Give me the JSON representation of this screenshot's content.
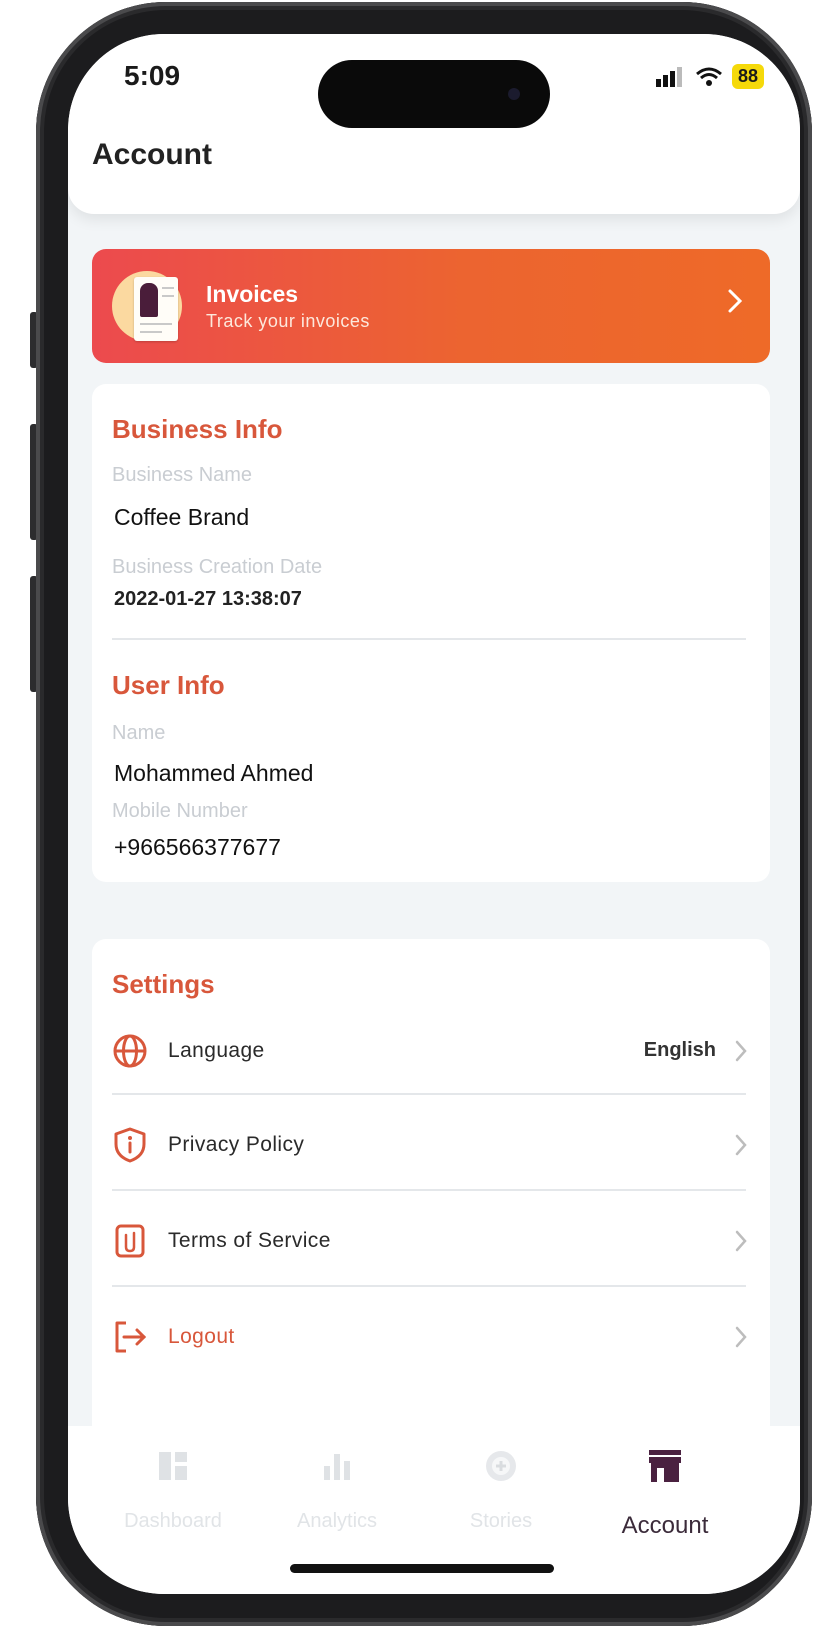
{
  "status_bar": {
    "time": "5:09",
    "battery": "88"
  },
  "header": {
    "title": "Account"
  },
  "invoices": {
    "title": "Invoices",
    "subtitle": "Track your invoices"
  },
  "business_info": {
    "section_title": "Business Info",
    "name_label": "Business Name",
    "name_value": "Coffee Brand",
    "date_label": "Business Creation Date",
    "date_value": "2022-01-27 13:38:07"
  },
  "user_info": {
    "section_title": "User Info",
    "name_label": "Name",
    "name_value": "Mohammed Ahmed",
    "mobile_label": "Mobile Number",
    "mobile_value": "+966566377677"
  },
  "settings": {
    "section_title": "Settings",
    "items": [
      {
        "label": "Language",
        "value": "English",
        "icon": "globe-icon"
      },
      {
        "label": "Privacy Policy",
        "icon": "shield-info-icon"
      },
      {
        "label": "Terms of Service",
        "icon": "document-clip-icon"
      },
      {
        "label": "Logout",
        "icon": "logout-icon"
      }
    ]
  },
  "tabs": [
    {
      "label": "Dashboard",
      "icon": "dashboard-icon",
      "active": false
    },
    {
      "label": "Analytics",
      "icon": "bar-chart-icon",
      "active": false
    },
    {
      "label": "Stories",
      "icon": "stories-icon",
      "active": false
    },
    {
      "label": "Account",
      "icon": "store-icon",
      "active": true
    }
  ],
  "colors": {
    "accent": "#d8573b",
    "gradient_start": "#ec4a4e",
    "gradient_end": "#ee6a28",
    "active_tab": "#3b2b3a"
  }
}
